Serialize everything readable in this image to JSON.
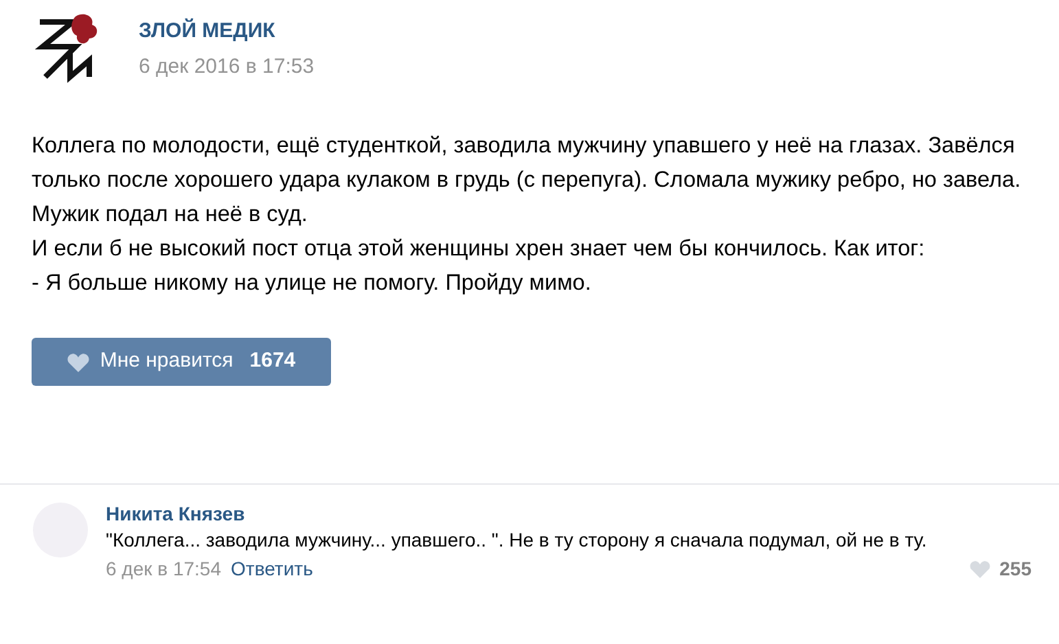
{
  "post": {
    "author": "ЗЛОЙ МЕДИК",
    "date": "6 дек 2016 в 17:53",
    "paragraphs": [
      "Коллега по молодости, ещё студенткой, заводила мужчину упавшего у неё на глазах. Завёлся только после хорошего удара кулаком в грудь (с перепуга). Сломала мужику ребро, но завела. Мужик подал на неё в суд.",
      "И если б не высокий пост отца этой женщины хрен знает чем бы кончилось. Как итог:",
      "- Я больше никому на улице не помогу. Пройду мимо."
    ],
    "like_button": {
      "label": "Мне нравится",
      "count": "1674"
    }
  },
  "comment": {
    "author": "Никита Князев",
    "text": "\"Коллега... заводила мужчину... упавшего.. \". Не в ту сторону я сначала подумал, ой не в ту.",
    "date": "6 дек в 17:54",
    "reply": "Ответить",
    "likes": "255"
  }
}
